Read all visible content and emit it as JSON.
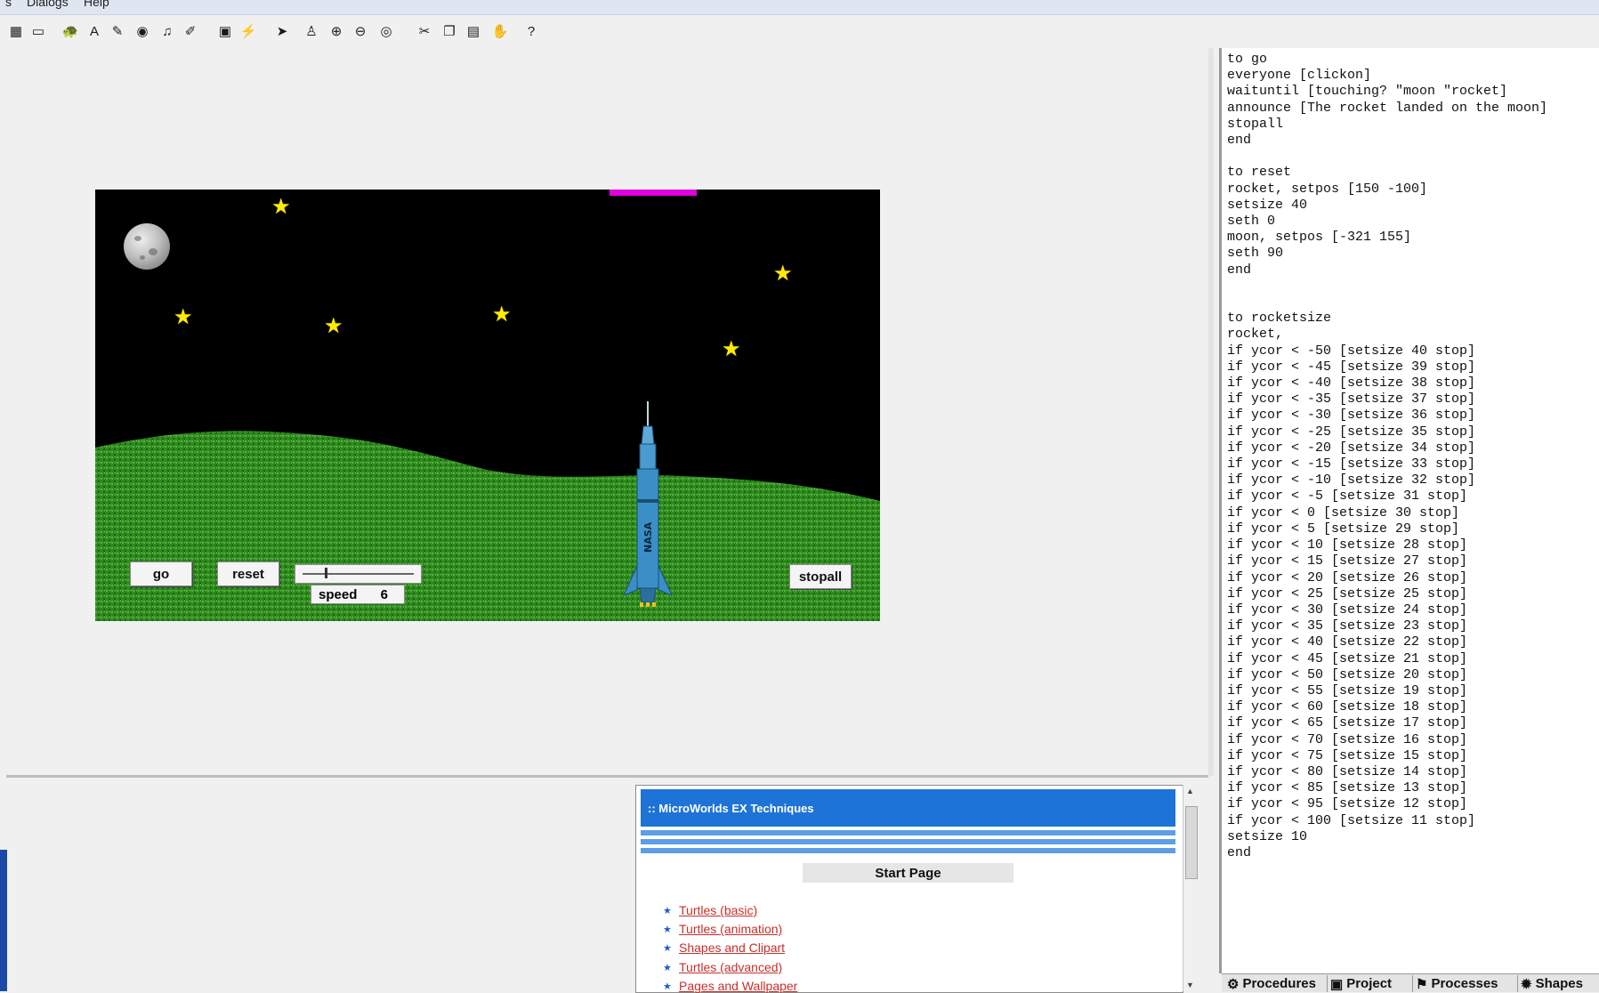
{
  "menubar": {
    "items": [
      "s",
      "Dialogs",
      "Help"
    ]
  },
  "toolbar": {
    "icons": [
      "grid-icon",
      "rectangle-icon",
      "turtle-icon",
      "text-box-icon",
      "paint-icon",
      "eye-icon",
      "music-note-icon",
      "pen-icon",
      "backpack-icon",
      "lightning-icon",
      "pointer-icon",
      "stamp-icon",
      "zoom-in-icon",
      "zoom-out-icon",
      "eye-view-icon",
      "scissors-icon",
      "copy-icon",
      "paste-icon",
      "stop-icon",
      "help-question-icon"
    ],
    "glyphs": [
      "▦",
      "▭",
      "🐢",
      "A",
      "✎",
      "◉",
      "♫",
      "✐",
      "▣",
      "⚡",
      "➤",
      "♙",
      "⊕",
      "⊖",
      "◎",
      "✂",
      "❐",
      "▤",
      "✋",
      "?"
    ]
  },
  "stage": {
    "buttons": {
      "go": "go",
      "reset": "reset",
      "stopall": "stopall"
    },
    "slider": {
      "label": "speed",
      "value": "6",
      "fraction": 0.2
    },
    "rocket_label": "NASA"
  },
  "procedures": {
    "text": "to go\neveryone [clickon]\nwaituntil [touching? \"moon \"rocket]\nannounce [The rocket landed on the moon]\nstopall\nend\n\nto reset\nrocket, setpos [150 -100]\nsetsize 40\nseth 0\nmoon, setpos [-321 155]\nseth 90\nend\n\n\nto rocketsize\nrocket,\nif ycor < -50 [setsize 40 stop]\nif ycor < -45 [setsize 39 stop]\nif ycor < -40 [setsize 38 stop]\nif ycor < -35 [setsize 37 stop]\nif ycor < -30 [setsize 36 stop]\nif ycor < -25 [setsize 35 stop]\nif ycor < -20 [setsize 34 stop]\nif ycor < -15 [setsize 33 stop]\nif ycor < -10 [setsize 32 stop]\nif ycor < -5 [setsize 31 stop]\nif ycor < 0 [setsize 30 stop]\nif ycor < 5 [setsize 29 stop]\nif ycor < 10 [setsize 28 stop]\nif ycor < 15 [setsize 27 stop]\nif ycor < 20 [setsize 26 stop]\nif ycor < 25 [setsize 25 stop]\nif ycor < 30 [setsize 24 stop]\nif ycor < 35 [setsize 23 stop]\nif ycor < 40 [setsize 22 stop]\nif ycor < 45 [setsize 21 stop]\nif ycor < 50 [setsize 20 stop]\nif ycor < 55 [setsize 19 stop]\nif ycor < 60 [setsize 18 stop]\nif ycor < 65 [setsize 17 stop]\nif ycor < 70 [setsize 16 stop]\nif ycor < 75 [setsize 15 stop]\nif ycor < 80 [setsize 14 stop]\nif ycor < 85 [setsize 13 stop]\nif ycor < 95 [setsize 12 stop]\nif ycor < 100 [setsize 11 stop]\nsetsize 10\nend"
  },
  "tabs": [
    "Procedures",
    "Project",
    "Processes",
    "Shapes"
  ],
  "help": {
    "title": ":: MicroWorlds EX Techniques",
    "start_page": "Start Page",
    "links": [
      "Turtles (basic)",
      "Turtles (animation)",
      "Shapes and Clipart",
      "Turtles (advanced)",
      "Pages and Wallpaper"
    ]
  },
  "colors": {
    "accent": "#1e73d6",
    "link": "#c4302b",
    "stage_bg": "#000000",
    "grass": "#2f8a1f",
    "star": "#ffeb00",
    "rocket": "#3a8fc7"
  }
}
